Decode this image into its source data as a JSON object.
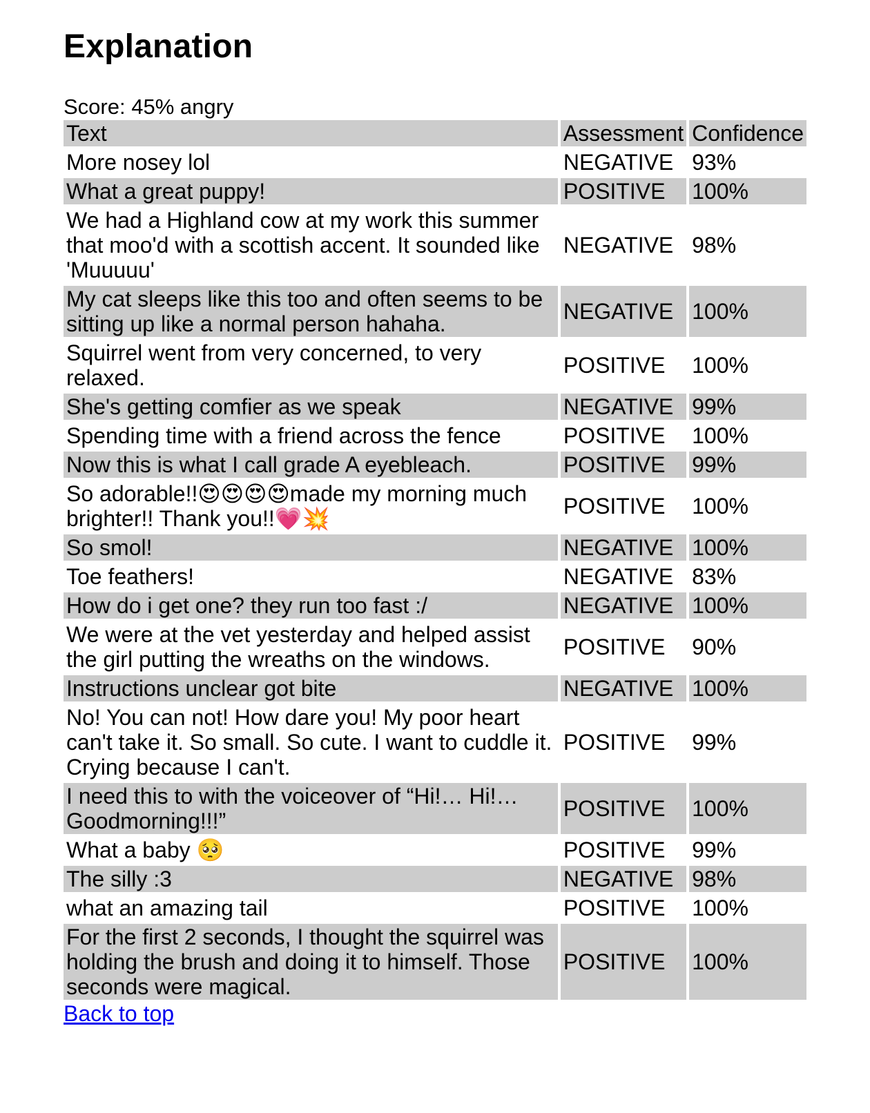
{
  "page": {
    "heading": "Explanation",
    "score_line": "Score: 45% angry",
    "back_link": "Back to top"
  },
  "table": {
    "headers": [
      "Text",
      "Assessment",
      "Confidence"
    ],
    "rows": [
      {
        "text": "More nosey lol",
        "assessment": "NEGATIVE",
        "confidence": "93%"
      },
      {
        "text": "What a great puppy!",
        "assessment": "POSITIVE",
        "confidence": "100%"
      },
      {
        "text": "We had a Highland cow at my work this summer that moo'd with a scottish accent. It sounded like 'Muuuuu'",
        "assessment": "NEGATIVE",
        "confidence": "98%"
      },
      {
        "text": "My cat sleeps like this too and often seems to be sitting up like a normal person hahaha.",
        "assessment": "NEGATIVE",
        "confidence": "100%"
      },
      {
        "text": "Squirrel went from very concerned, to very relaxed.",
        "assessment": "POSITIVE",
        "confidence": "100%"
      },
      {
        "text": "She's getting comfier as we speak",
        "assessment": "NEGATIVE",
        "confidence": "99%"
      },
      {
        "text": "Spending time with a friend across the fence",
        "assessment": "POSITIVE",
        "confidence": "100%"
      },
      {
        "text": "Now this is what I call grade A eyebleach.",
        "assessment": "POSITIVE",
        "confidence": "99%"
      },
      {
        "text": "So adorable!!😍😍😍😍made my morning much brighter!! Thank you!!💗💥",
        "assessment": "POSITIVE",
        "confidence": "100%"
      },
      {
        "text": "So smol!",
        "assessment": "NEGATIVE",
        "confidence": "100%"
      },
      {
        "text": "Toe feathers!",
        "assessment": "NEGATIVE",
        "confidence": "83%"
      },
      {
        "text": "How do i get one? they run too fast :/",
        "assessment": "NEGATIVE",
        "confidence": "100%"
      },
      {
        "text": "We were at the vet yesterday and helped assist the girl putting the wreaths on the windows.",
        "assessment": "POSITIVE",
        "confidence": "90%"
      },
      {
        "text": "Instructions unclear got bite",
        "assessment": "NEGATIVE",
        "confidence": "100%"
      },
      {
        "text": "No! You can not! How dare you! My poor heart can't take it. So small. So cute. I want to cuddle it. Crying because I can't.",
        "assessment": "POSITIVE",
        "confidence": "99%"
      },
      {
        "text": "I need this to with the voiceover of “Hi!… Hi!… Goodmorning!!!”",
        "assessment": "POSITIVE",
        "confidence": "100%"
      },
      {
        "text": "What a baby 🥺",
        "assessment": "POSITIVE",
        "confidence": "99%"
      },
      {
        "text": "The silly :3",
        "assessment": "NEGATIVE",
        "confidence": "98%"
      },
      {
        "text": "what an amazing tail",
        "assessment": "POSITIVE",
        "confidence": "100%"
      },
      {
        "text": "For the first 2 seconds, I thought the squirrel was holding the brush and doing it to himself. Those seconds were magical.",
        "assessment": "POSITIVE",
        "confidence": "100%"
      }
    ]
  },
  "colors": {
    "row_shade": "#cccccc",
    "link": "#0000ee",
    "background": "#ffffff"
  }
}
